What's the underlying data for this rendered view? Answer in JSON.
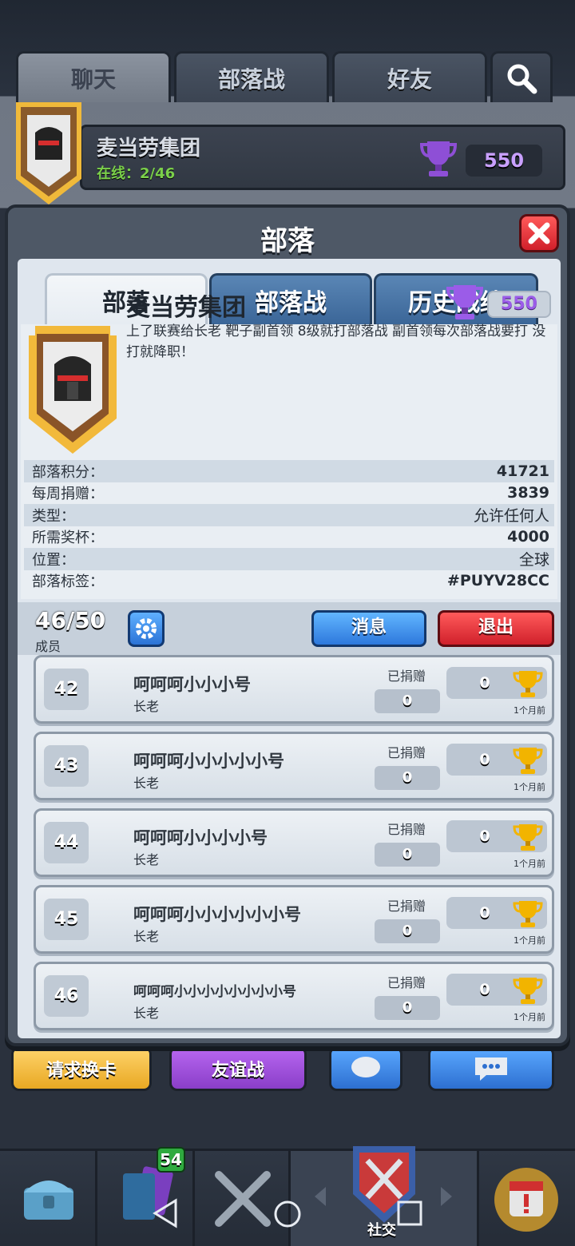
{
  "top_tabs": {
    "chat": "聊天",
    "clan_war": "部落战",
    "friends": "好友"
  },
  "clan_strip": {
    "name": "麦当劳集团",
    "online": "在线：2/46",
    "trophies": "550"
  },
  "bottom_buttons": {
    "request": "请求换卡",
    "friendly": "友谊战"
  },
  "nav": {
    "cards_badge": "54",
    "social": "社交"
  },
  "modal": {
    "title": "部落",
    "tabs": [
      "部落",
      "部落战",
      "历史战绩"
    ],
    "clan": {
      "name": "麦当劳集团",
      "trophies": "550",
      "description": "上了联赛给长老 靶子副首领 8级就打部落战 副首领每次部落战要打 没打就降职！"
    },
    "stats": [
      {
        "label": "部落积分：",
        "value": "41721"
      },
      {
        "label": "每周捐赠：",
        "value": "3839"
      },
      {
        "label": "类型：",
        "value": "允许任何人"
      },
      {
        "label": "所需奖杯：",
        "value": "4000"
      },
      {
        "label": "位置：",
        "value": "全球"
      },
      {
        "label": "部落标签：",
        "value": "#PUYV28CC"
      }
    ],
    "members_header": {
      "count": "46/50",
      "label": "成员",
      "message_button": "消息",
      "leave_button": "退出"
    },
    "members": [
      {
        "rank": "42",
        "name": "呵呵呵小小小号",
        "role": "长老",
        "donated_label": "已捐赠",
        "donated": "0",
        "trophies": "0",
        "last_seen": "1个月前"
      },
      {
        "rank": "43",
        "name": "呵呵呵小小小小小号",
        "role": "长老",
        "donated_label": "已捐赠",
        "donated": "0",
        "trophies": "0",
        "last_seen": "1个月前"
      },
      {
        "rank": "44",
        "name": "呵呵呵小小小小号",
        "role": "长老",
        "donated_label": "已捐赠",
        "donated": "0",
        "trophies": "0",
        "last_seen": "1个月前"
      },
      {
        "rank": "45",
        "name": "呵呵呵小小小小小小号",
        "role": "长老",
        "donated_label": "已捐赠",
        "donated": "0",
        "trophies": "0",
        "last_seen": "1个月前"
      },
      {
        "rank": "46",
        "name": "呵呵呵小小小小小小小小号",
        "role": "长老",
        "donated_label": "已捐赠",
        "donated": "0",
        "trophies": "0",
        "last_seen": "1个月前"
      }
    ]
  },
  "colors": {
    "accent_blue": "#2d78dc",
    "danger_red": "#d0202b",
    "trophy_purple": "#9b5ce8",
    "trophy_gold": "#f2b400"
  }
}
